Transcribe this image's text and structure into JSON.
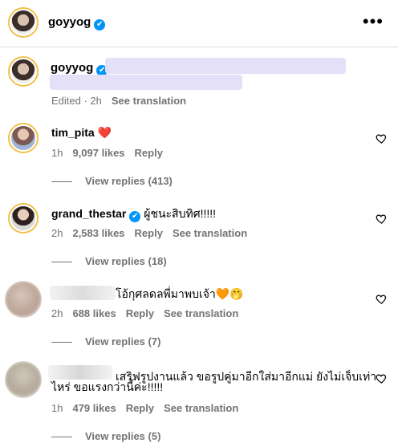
{
  "header": {
    "username": "goyyog",
    "verified": "✔",
    "more": "•••"
  },
  "post": {
    "username": "goyyog",
    "verified": "✔",
    "edited": "Edited · 2h",
    "see_translation": "See translation"
  },
  "comments": [
    {
      "user": "tim_pita",
      "verified": false,
      "text": "❤️",
      "time": "1h",
      "likes": "9,097 likes",
      "reply": "Reply",
      "translate": "",
      "view_replies": "View replies (413)"
    },
    {
      "user": "grand_thestar",
      "verified": true,
      "text": "ผู้ชนะสิบทิศ!!!!!",
      "time": "2h",
      "likes": "2,583 likes",
      "reply": "Reply",
      "translate": "See translation",
      "view_replies": "View replies (18)"
    },
    {
      "user": "",
      "verified": false,
      "text": "โอ้กุศลดลพี่มาพบเจ้า🧡🤭",
      "time": "2h",
      "likes": "688 likes",
      "reply": "Reply",
      "translate": "See translation",
      "view_replies": "View replies (7)"
    },
    {
      "user": "",
      "verified": false,
      "text_line1": "เสริฟรูปงานแล้ว ขอรูปคู่มาอีกใส่มาอีกแม่ ยังไม่เจ็บเท่า",
      "text_line2": "ไหร่ ขอแรงกว่านี้ค่ะ!!!!!",
      "time": "1h",
      "likes": "479 likes",
      "reply": "Reply",
      "translate": "See translation",
      "view_replies": "View replies (5)"
    }
  ],
  "colors": {
    "accent": "#0095f6",
    "muted": "#737373",
    "ring": "#f0c14b",
    "redacted": "#e4e0f7"
  }
}
